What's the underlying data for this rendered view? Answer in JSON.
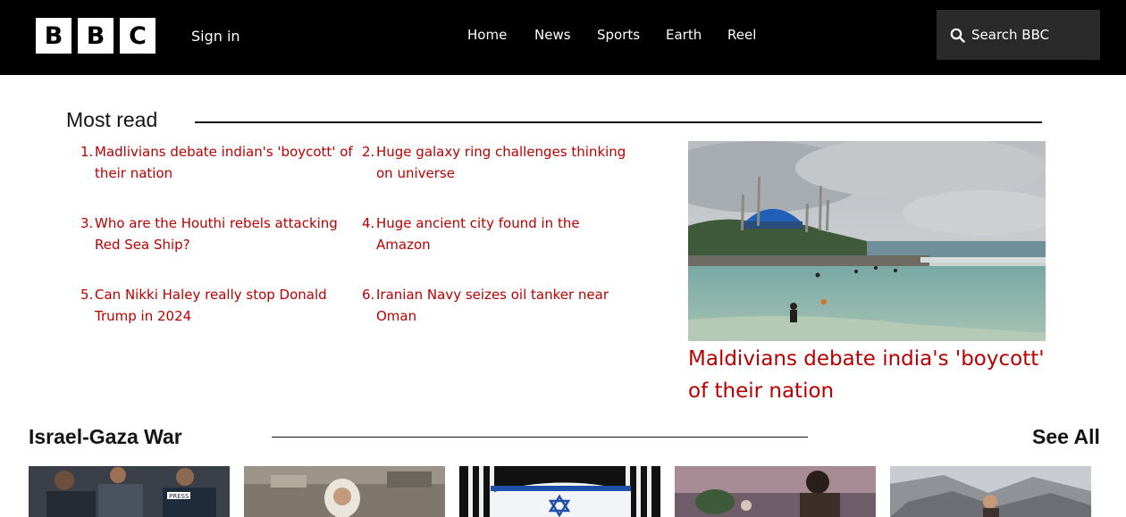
{
  "header": {
    "logo_letters": [
      "B",
      "B",
      "C"
    ],
    "sign_in": "Sign in",
    "nav": [
      "Home",
      "News",
      "Sports",
      "Earth",
      "Reel"
    ],
    "search_placeholder": "Search BBC",
    "icon": "search-icon"
  },
  "most_read": {
    "title": "Most read",
    "items": [
      {
        "num": "1.",
        "text": "Madlivians debate indian's 'boycott' of their nation"
      },
      {
        "num": "2.",
        "text": "Huge galaxy ring challenges thinking on universe"
      },
      {
        "num": "3.",
        "text": "Who are the Houthi rebels attacking Red Sea Ship?"
      },
      {
        "num": "4.",
        "text": "Huge ancient city found in the Amazon"
      },
      {
        "num": "5.",
        "text": "Can Nikki Haley really stop Donald Trump in 2024"
      },
      {
        "num": "6.",
        "text": "Iranian Navy seizes oil tanker near Oman"
      }
    ],
    "feature_caption": "Maldivians debate india's 'boycott' of their nation"
  },
  "israel_gaza": {
    "title": "Israel-Gaza War",
    "see_all": "See All",
    "thumb_labels": [
      "PRESS"
    ]
  },
  "colors": {
    "header_bg": "#000000",
    "link_red": "#b80000",
    "search_bg": "#2a2a2a"
  }
}
